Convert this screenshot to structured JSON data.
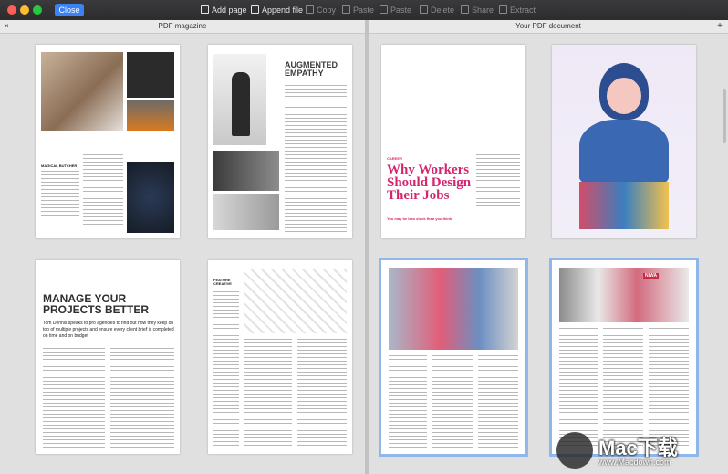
{
  "toolbar": {
    "close_label": "Close",
    "add_page": "Add page",
    "append_file": "Append file",
    "copy": "Copy",
    "paste1": "Paste",
    "paste2": "Paste",
    "delete": "Delete",
    "share": "Share",
    "extract": "Extract"
  },
  "left_pane": {
    "title": "PDF magazine",
    "close_glyph": "×"
  },
  "right_pane": {
    "title": "Your PDF document",
    "add_glyph": "+"
  },
  "pages": {
    "p1_caption": "MAGICAL BUTCHER",
    "p2_title": "AUGMENTED EMPATHY",
    "p3_title": "MANAGE YOUR PROJECTS BETTER",
    "p3_sub": "Tom Dennis speaks to pro agencies to find out how they keep on top of multiple projects and ensure every client brief is completed on time and on budget",
    "p4_label": "FEATURE CREATIVE",
    "p5_kicker": "CAREER",
    "p5_title": "Why Workers Should Design Their Jobs",
    "p5_sub": "You may be less stuck than you think.",
    "p8_sign": "NIWA"
  },
  "watermark": {
    "title": "Mac下载",
    "url": "www.Macdown.com"
  },
  "colors": {
    "accent": "#3b82f6",
    "headline_pink": "#d6246e",
    "selection": "#8fb7ea"
  }
}
